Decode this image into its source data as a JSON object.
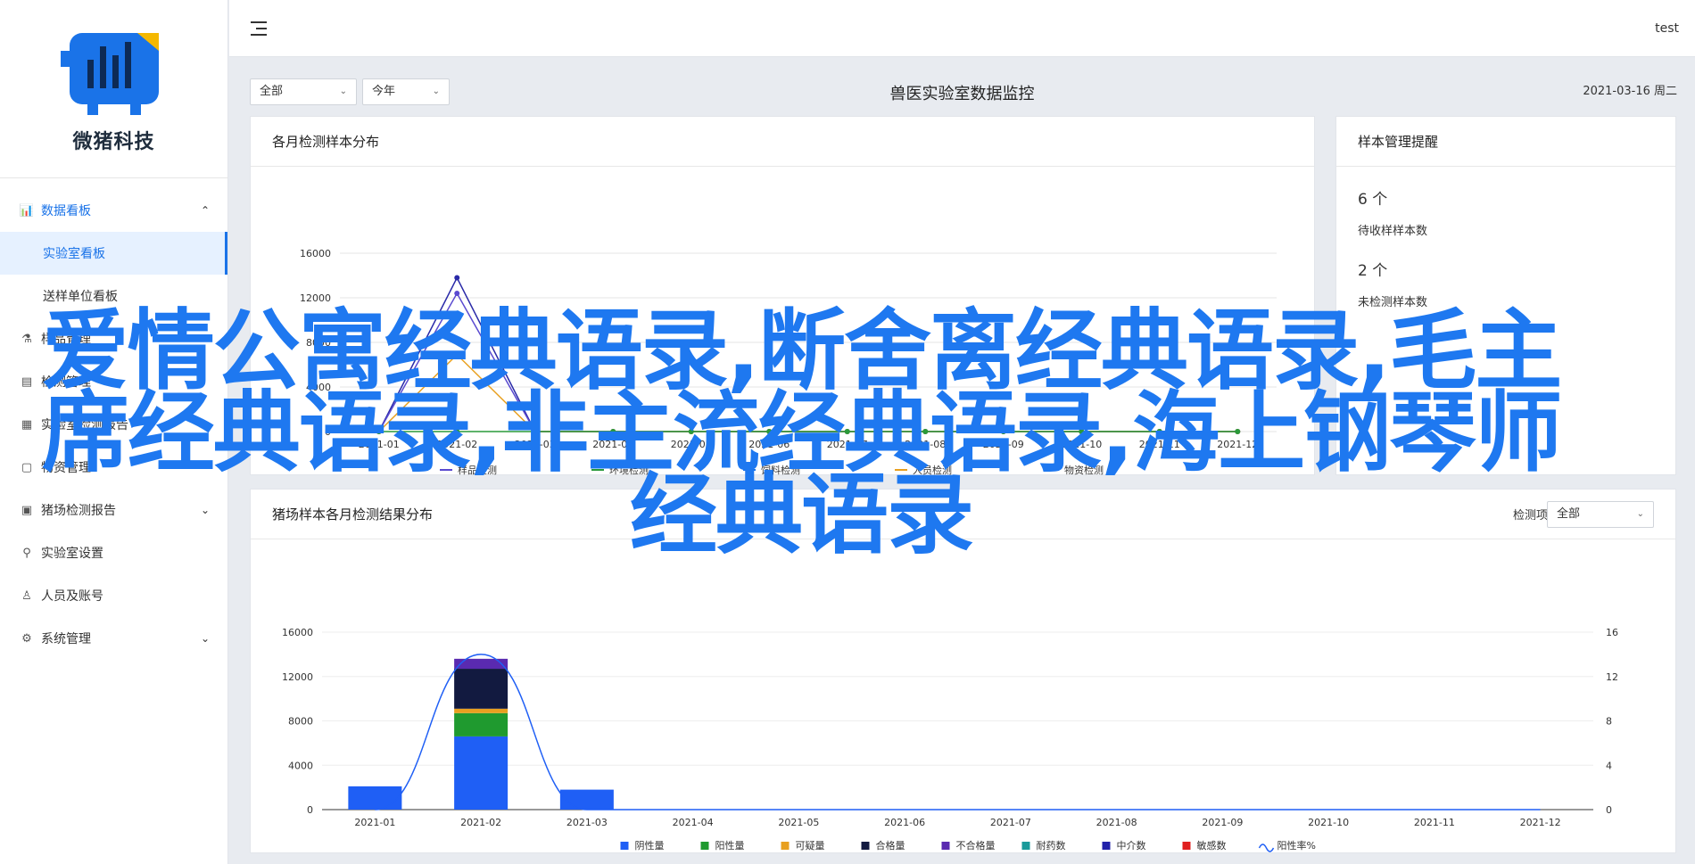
{
  "brand": {
    "name": "微猪科技",
    "logo_icon": "pig-bar-chart-logo"
  },
  "user": {
    "name": "test"
  },
  "sidebar": {
    "items": [
      {
        "label": "数据看板",
        "icon": "bar-chart-icon",
        "expanded": true,
        "children": [
          {
            "label": "实验室看板",
            "active": true
          },
          {
            "label": "送样单位看板"
          }
        ]
      },
      {
        "label": "样品管理",
        "icon": "flask-icon"
      },
      {
        "label": "检测管理",
        "icon": "clipboard-icon"
      },
      {
        "label": "实验室检测报告",
        "icon": "report-icon"
      },
      {
        "label": "物资管理",
        "icon": "box-icon"
      },
      {
        "label": "猪场检测报告",
        "icon": "document-icon",
        "chevron": true
      },
      {
        "label": "实验室设置",
        "icon": "lab-icon"
      },
      {
        "label": "人员及账号",
        "icon": "person-icon"
      },
      {
        "label": "系统管理",
        "icon": "gear-icon",
        "chevron": true
      }
    ]
  },
  "filters": {
    "scope": "全部",
    "period": "今年"
  },
  "header": {
    "title": "兽医实验室数据监控",
    "date": "2021-03-16 周二"
  },
  "monthly_card": {
    "title": "各月检测样本分布"
  },
  "reminder_card": {
    "title": "样本管理提醒",
    "items": [
      {
        "value": "6 个",
        "label": "待收样样本数"
      },
      {
        "value": "2 个",
        "label": "未检测样本数"
      }
    ]
  },
  "farm_card": {
    "title": "猪场样本各月检测结果分布",
    "filter_label": "检测项目",
    "filter_value": "全部"
  },
  "overlay": {
    "text": "爱情公寓经典语录,断舍离经典语录,毛主席经典语录,非主流经典语录,海上钢琴师经典语录"
  },
  "chart_data": [
    {
      "type": "line",
      "title": "各月检测样本分布",
      "categories": [
        "2021-01",
        "2021-02",
        "2021-03",
        "2021-04",
        "2021-05",
        "2021-06",
        "2021-07",
        "2021-08",
        "2021-09",
        "2021-10",
        "2021-11",
        "2021-12"
      ],
      "y_ticks": [
        0,
        4000,
        8000,
        12000,
        16000
      ],
      "ylim": [
        0,
        16000
      ],
      "series": [
        {
          "name": "",
          "color": "#2a2aa8",
          "values": [
            0,
            13800,
            0,
            0,
            0,
            0,
            0,
            0,
            0,
            0,
            0,
            0
          ]
        },
        {
          "name": "样品检测",
          "color": "#5a4ad0",
          "values": [
            0,
            12400,
            0,
            0,
            0,
            0,
            0,
            0,
            0,
            0,
            0,
            0
          ]
        },
        {
          "name": "",
          "color": "#e8a020",
          "values": [
            0,
            6900,
            0,
            0,
            0,
            0,
            0,
            0,
            0,
            0,
            0,
            0
          ]
        },
        {
          "name": "环境检测",
          "color": "#2a9a3a",
          "values": [
            0,
            0,
            0,
            0,
            0,
            0,
            0,
            0,
            0,
            0,
            0,
            0
          ]
        }
      ],
      "legend": [
        "样品检测",
        "环境检测",
        "饲料检测",
        "人员检测",
        "物资检测"
      ],
      "legend_colors": [
        "#5a4ad0",
        "#2a9a3a",
        "#1a73e8",
        "#e8a020",
        "#5a2ab0"
      ]
    },
    {
      "type": "bar",
      "title": "猪场样本各月检测结果分布",
      "categories": [
        "2021-01",
        "2021-02",
        "2021-03",
        "2021-04",
        "2021-05",
        "2021-06",
        "2021-07",
        "2021-08",
        "2021-09",
        "2021-10",
        "2021-11",
        "2021-12"
      ],
      "y_ticks": [
        0,
        4000,
        8000,
        12000,
        16000
      ],
      "y2_ticks": [
        0,
        4,
        8,
        12,
        16
      ],
      "ylim": [
        0,
        16000
      ],
      "y2lim": [
        0,
        16
      ],
      "stack_series": [
        {
          "name": "阴性量",
          "color": "#1f5ff5",
          "values": [
            2100,
            6600,
            1800,
            0,
            0,
            0,
            0,
            0,
            0,
            0,
            0,
            0
          ]
        },
        {
          "name": "阳性量",
          "color": "#1f9a2f",
          "values": [
            0,
            2100,
            0,
            0,
            0,
            0,
            0,
            0,
            0,
            0,
            0,
            0
          ]
        },
        {
          "name": "可疑量",
          "color": "#e8a020",
          "values": [
            0,
            400,
            0,
            0,
            0,
            0,
            0,
            0,
            0,
            0,
            0,
            0
          ]
        },
        {
          "name": "合格量",
          "color": "#121a40",
          "values": [
            0,
            3600,
            0,
            0,
            0,
            0,
            0,
            0,
            0,
            0,
            0,
            0
          ]
        },
        {
          "name": "不合格量",
          "color": "#5a2ab0",
          "values": [
            0,
            900,
            0,
            0,
            0,
            0,
            0,
            0,
            0,
            0,
            0,
            0
          ]
        },
        {
          "name": "耐药数",
          "color": "#1a9a9a",
          "values": [
            0,
            0,
            0,
            0,
            0,
            0,
            0,
            0,
            0,
            0,
            0,
            0
          ]
        },
        {
          "name": "中介数",
          "color": "#2222aa",
          "values": [
            0,
            0,
            0,
            0,
            0,
            0,
            0,
            0,
            0,
            0,
            0,
            0
          ]
        },
        {
          "name": "敏感数",
          "color": "#e02020",
          "values": [
            0,
            0,
            0,
            0,
            0,
            0,
            0,
            0,
            0,
            0,
            0,
            0
          ]
        }
      ],
      "line_series": {
        "name": "阳性率%",
        "color": "#1f5ff5",
        "values": [
          0,
          14,
          0,
          0,
          0,
          0,
          0,
          0,
          0,
          0,
          0,
          0
        ]
      }
    }
  ]
}
